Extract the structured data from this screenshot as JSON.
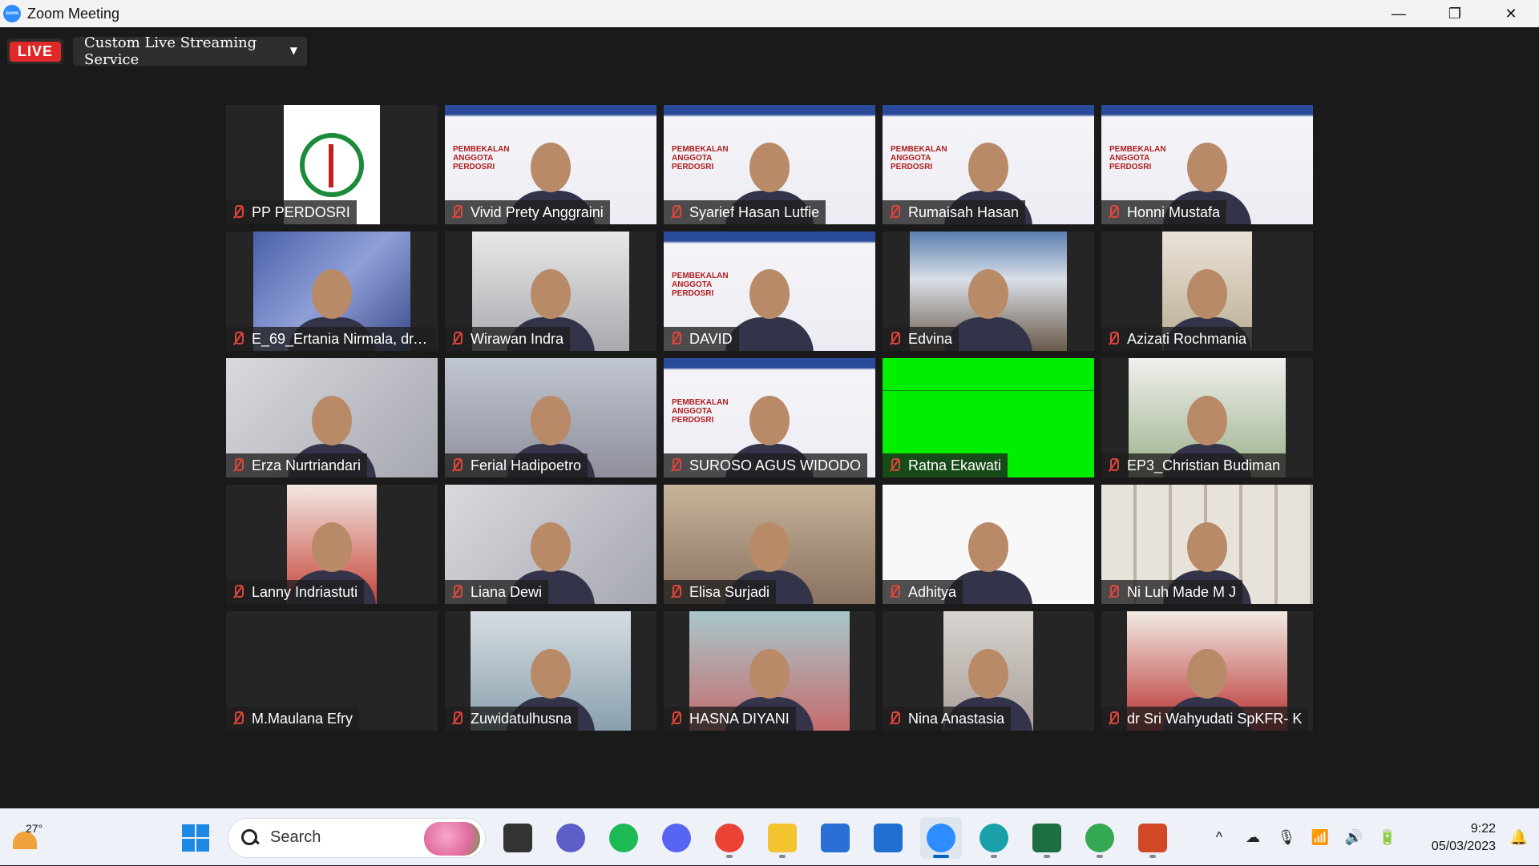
{
  "window": {
    "title": "Zoom Meeting",
    "app_icon_text": "zoom",
    "controls": [
      "—",
      "❐",
      "✕"
    ]
  },
  "toolbar": {
    "live_label": "LIVE",
    "stream_service": "Custom Live Streaming Service"
  },
  "slide_title": "PEMBEKALAN\nANGGOTA\nPERDOSRI",
  "participants": [
    {
      "name": "PP PERDOSRI",
      "bg": "logo"
    },
    {
      "name": "Vivid Prety Anggraini",
      "bg": "slide",
      "active": true
    },
    {
      "name": "Syarief Hasan Lutfie",
      "bg": "slide"
    },
    {
      "name": "Rumaisah Hasan",
      "bg": "slide"
    },
    {
      "name": "Honni Mustafa",
      "bg": "slide"
    },
    {
      "name": "E_69_Ertania Nirmala, dr.,...",
      "bg": "blue"
    },
    {
      "name": "Wirawan Indra",
      "bg": "room"
    },
    {
      "name": "DAVID",
      "bg": "slide"
    },
    {
      "name": "Edvina",
      "bg": "mountain"
    },
    {
      "name": "Azizati Rochmania",
      "bg": "beige"
    },
    {
      "name": "Erza Nurtriandari",
      "bg": "light"
    },
    {
      "name": "Ferial Hadipoetro",
      "bg": "pink"
    },
    {
      "name": "SUROSO AGUS WIDODO",
      "bg": "slide"
    },
    {
      "name": "Ratna Ekawati",
      "bg": "green"
    },
    {
      "name": "EP3_Christian Budiman",
      "bg": "garden"
    },
    {
      "name": "Lanny Indriastuti",
      "bg": "flower"
    },
    {
      "name": "Liana Dewi",
      "bg": "light"
    },
    {
      "name": "Elisa Surjadi",
      "bg": "office"
    },
    {
      "name": "Adhitya",
      "bg": "white"
    },
    {
      "name": "Ni Luh Made M J",
      "bg": "shelf"
    },
    {
      "name": "M.Maulana Efry",
      "bg": "none"
    },
    {
      "name": "Zuwidatulhusna",
      "bg": "car"
    },
    {
      "name": "HASNA DIYANI",
      "bg": "campus"
    },
    {
      "name": "Nina Anastasia",
      "bg": "nina"
    },
    {
      "name": "dr Sri Wahyudati SpKFR- K",
      "bg": "sri"
    }
  ],
  "taskbar": {
    "weather_temp": "27°",
    "search_placeholder": "Search",
    "apps": [
      {
        "name": "task-view",
        "color": "#333333"
      },
      {
        "name": "teams-chat",
        "color": "#5b5fc7"
      },
      {
        "name": "spotify",
        "color": "#1db954"
      },
      {
        "name": "discord",
        "color": "#5865f2"
      },
      {
        "name": "chrome",
        "color": "#ea4335",
        "open": true
      },
      {
        "name": "file-explorer",
        "color": "#f4c430",
        "open": true
      },
      {
        "name": "microsoft-store",
        "color": "#2a6fd6"
      },
      {
        "name": "mail",
        "color": "#1f6fd0"
      },
      {
        "name": "zoom",
        "color": "#2d8cff",
        "active": true
      },
      {
        "name": "edge",
        "color": "#1aa0a8",
        "open": true
      },
      {
        "name": "excel",
        "color": "#1d6f42",
        "open": true
      },
      {
        "name": "chrome-profile",
        "color": "#34a853",
        "open": true
      },
      {
        "name": "powerpoint",
        "color": "#d24726",
        "open": true
      }
    ],
    "tray": {
      "chevron": "^",
      "time": "9:22",
      "date": "05/03/2023"
    }
  }
}
